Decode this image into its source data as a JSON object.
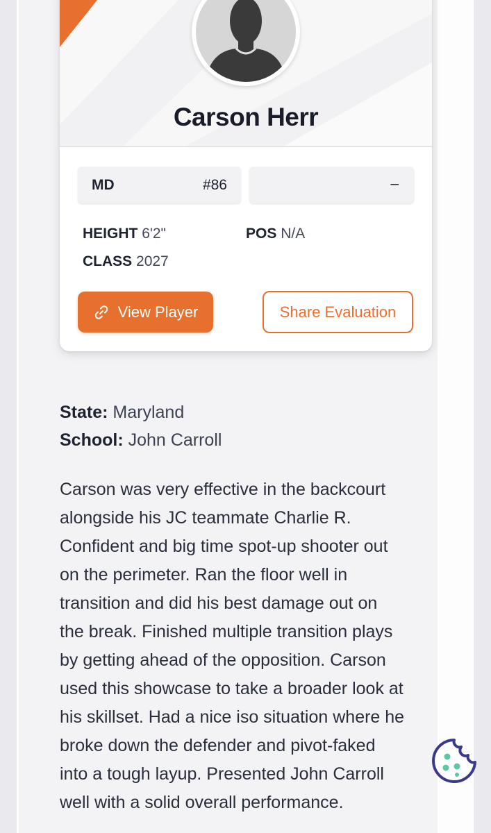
{
  "player": {
    "name": "Carson Herr",
    "state_abbr": "MD",
    "number": "#86",
    "secondary_value": "–",
    "height_label": "HEIGHT",
    "height": "6'2\"",
    "pos_label": "POS",
    "pos": "N/A",
    "class_label": "CLASS",
    "class_year": "2027"
  },
  "actions": {
    "view_player": "View Player",
    "share_evaluation": "Share Evaluation"
  },
  "details": {
    "state_label": "State:",
    "state": "Maryland",
    "school_label": "School:",
    "school": "John Carroll"
  },
  "evaluation_lines": [
    "Carson was very effective in the backcourt",
    "alongside his JC teammate Charlie R.",
    "Confident and big time spot-up shooter out",
    "on the perimeter. Ran the floor well in",
    "transition and did his best damage out on",
    "the break. Finished multiple transition plays",
    "by getting ahead of the opposition. Carson",
    "used this showcase to take a broader look at",
    "his skillset. Had a nice iso situation where he",
    "broke down the defender and pivot-faked",
    "into a tough layup. Presented John Carroll",
    "well with a solid overall performance."
  ],
  "colors": {
    "accent": "#e8702f",
    "text": "#1f2330",
    "cookie": "#3b3a86"
  },
  "icons": {
    "link": "link-icon",
    "avatar": "avatar-silhouette-icon",
    "cookie": "cookie-icon"
  }
}
